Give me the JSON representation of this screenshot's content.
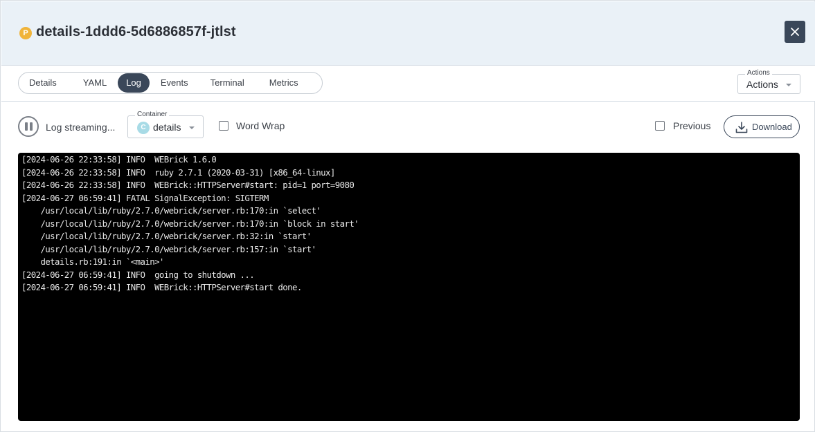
{
  "header": {
    "pod_badge": "P",
    "title": "details-1ddd6-5d6886857f-jtlst",
    "close_icon": "close-icon"
  },
  "tabs": [
    {
      "label": "Details",
      "active": false
    },
    {
      "label": "YAML",
      "active": false
    },
    {
      "label": "Log",
      "active": true
    },
    {
      "label": "Events",
      "active": false
    },
    {
      "label": "Terminal",
      "active": false
    },
    {
      "label": "Metrics",
      "active": false
    }
  ],
  "actions": {
    "legend": "Actions",
    "value": "Actions"
  },
  "controls": {
    "stream_label": "Log streaming...",
    "container_legend": "Container",
    "container_badge": "C",
    "container_value": "details",
    "word_wrap_label": "Word Wrap",
    "previous_label": "Previous",
    "download_label": "Download"
  },
  "colors": {
    "accent": "#3a4759",
    "header_bg": "#eaf1f7",
    "pod_badge": "#f0b43a",
    "container_badge": "#a8dbe6",
    "log_bg": "#000000",
    "log_text": "#e8e8e8"
  },
  "log_lines": [
    "[2024-06-26 22:33:58] INFO  WEBrick 1.6.0",
    "[2024-06-26 22:33:58] INFO  ruby 2.7.1 (2020-03-31) [x86_64-linux]",
    "[2024-06-26 22:33:58] INFO  WEBrick::HTTPServer#start: pid=1 port=9080",
    "[2024-06-27 06:59:41] FATAL SignalException: SIGTERM",
    "    /usr/local/lib/ruby/2.7.0/webrick/server.rb:170:in `select'",
    "    /usr/local/lib/ruby/2.7.0/webrick/server.rb:170:in `block in start'",
    "    /usr/local/lib/ruby/2.7.0/webrick/server.rb:32:in `start'",
    "    /usr/local/lib/ruby/2.7.0/webrick/server.rb:157:in `start'",
    "    details.rb:191:in `<main>'",
    "[2024-06-27 06:59:41] INFO  going to shutdown ...",
    "[2024-06-27 06:59:41] INFO  WEBrick::HTTPServer#start done."
  ]
}
